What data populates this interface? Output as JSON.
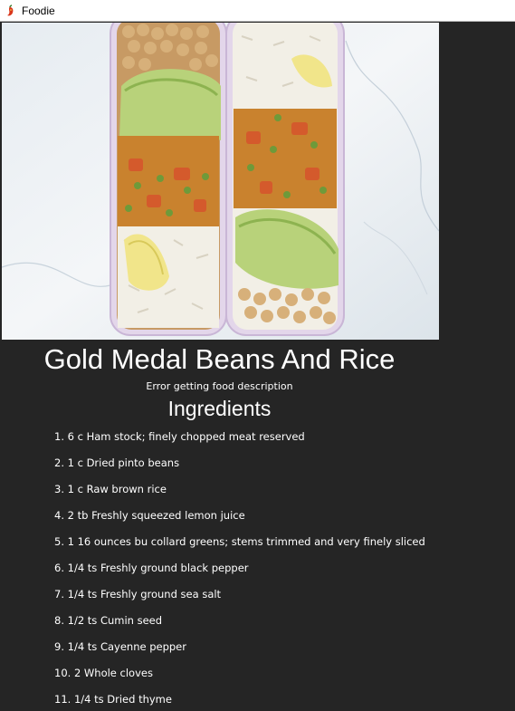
{
  "window": {
    "title": "Foodie",
    "icon": "chili-pepper-icon"
  },
  "recipe": {
    "title": "Gold Medal Beans And Rice",
    "description": "Error getting food description",
    "ingredients_heading": "Ingredients",
    "ingredients": [
      "1. 6 c Ham stock; finely chopped meat reserved",
      "2. 1 c Dried pinto beans",
      "3. 1 c Raw brown rice",
      "4. 2 tb Freshly squeezed lemon juice",
      "5. 1 16 ounces bu collard greens; stems trimmed and very finely sliced",
      "6. 1/4 ts Freshly ground black pepper",
      "7. 1/4 ts Freshly ground sea salt",
      "8. 1/2 ts Cumin seed",
      "9. 1/4 ts Cayenne pepper",
      "10. 2 Whole cloves",
      "11. 1/4 ts Dried thyme"
    ]
  }
}
